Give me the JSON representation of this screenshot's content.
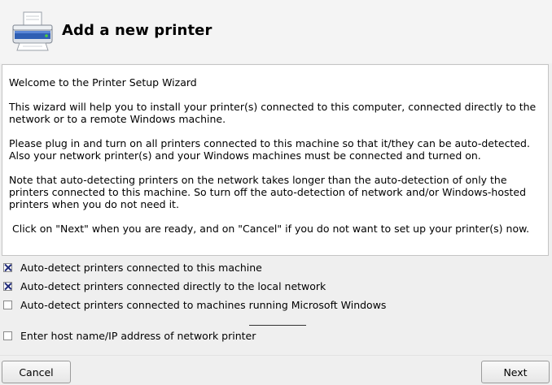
{
  "header": {
    "title": "Add a new printer",
    "icon": "printer-icon"
  },
  "content": {
    "paragraphs": [
      "Welcome to the Printer Setup Wizard",
      "This wizard will help you to install your printer(s) connected to this computer, connected directly to the network or to a remote Windows machine.",
      "Please plug in and turn on all printers connected to this machine so that it/they can be auto-detected. Also your network printer(s) and your Windows machines must be connected and turned on.",
      "Note that auto-detecting printers on the network takes longer than the auto-detection of only the printers connected to this machine. So turn off the auto-detection of network and/or Windows-hosted printers when you do not need it.",
      "Click on \"Next\" when you are ready, and on \"Cancel\" if you do not want to set up your printer(s) now."
    ]
  },
  "options": {
    "local": {
      "label": "Auto-detect printers connected to this machine",
      "checked": true
    },
    "network": {
      "label": "Auto-detect printers connected directly to the local network",
      "checked": true
    },
    "windows": {
      "label": "Auto-detect printers connected to machines running Microsoft Windows",
      "checked": false
    },
    "host": {
      "label": "Enter host name/IP address of network printer",
      "checked": false,
      "value": ""
    }
  },
  "buttons": {
    "cancel": "Cancel",
    "next": "Next"
  },
  "colors": {
    "background": "#efefef",
    "content_background": "#ffffff",
    "check_mark": "#1f2a7a"
  }
}
